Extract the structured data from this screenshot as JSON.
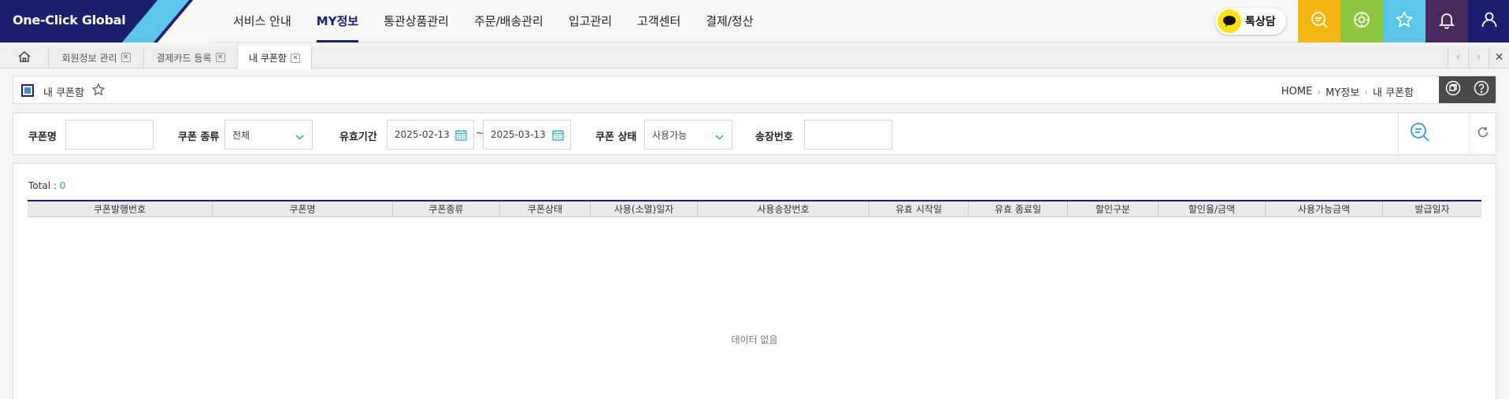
{
  "brand": {
    "logo_text": "One-Click Global",
    "navy": "#1a1f70",
    "accent": "#5ac7e8"
  },
  "nav": {
    "items": [
      {
        "label": "서비스 안내",
        "active": false
      },
      {
        "label": "MY정보",
        "active": true
      },
      {
        "label": "통관상품관리",
        "active": false
      },
      {
        "label": "주문/배송관리",
        "active": false
      },
      {
        "label": "입고관리",
        "active": false
      },
      {
        "label": "고객센터",
        "active": false
      },
      {
        "label": "결제/정산",
        "active": false
      }
    ]
  },
  "header_right": {
    "kakao_label": "톡상담",
    "quick_buttons": [
      {
        "icon": "chat-search-icon",
        "color": "#f5b612"
      },
      {
        "icon": "settings-cycle-icon",
        "color": "#8dc63f"
      },
      {
        "icon": "star-icon",
        "color": "#5ac7e8"
      },
      {
        "icon": "bell-icon",
        "color": "#4b2a5e"
      },
      {
        "icon": "user-icon",
        "color": "#1a1f70"
      }
    ]
  },
  "tabs": [
    {
      "label": "회원정보 관리",
      "active": false
    },
    {
      "label": "결제카드 등록",
      "active": false
    },
    {
      "label": "내 쿠폰함",
      "active": true
    }
  ],
  "page": {
    "title": "내 쿠폰함",
    "breadcrumb": [
      "HOME",
      "MY정보",
      "내 쿠폰함"
    ]
  },
  "filter": {
    "coupon_name_label": "쿠폰명",
    "coupon_name_value": "",
    "coupon_type_label": "쿠폰 종류",
    "coupon_type_value": "전체",
    "valid_period_label": "유효기간",
    "date_from": "2025-02-13",
    "date_sep": "~",
    "date_to": "2025-03-13",
    "coupon_status_label": "쿠폰 상태",
    "coupon_status_value": "사용가능",
    "invoice_label": "송장번호",
    "invoice_value": ""
  },
  "grid": {
    "total_label": "Total :",
    "total_count": "0",
    "columns": [
      "쿠폰발행번호",
      "쿠폰명",
      "쿠폰종류",
      "쿠폰상태",
      "사용(소멸)일자",
      "사용송장번호",
      "유효 시작일",
      "유효 종료일",
      "할인구분",
      "할인율/금액",
      "사용가능금액",
      "발급일자"
    ],
    "empty_text": "데이터 없음"
  }
}
